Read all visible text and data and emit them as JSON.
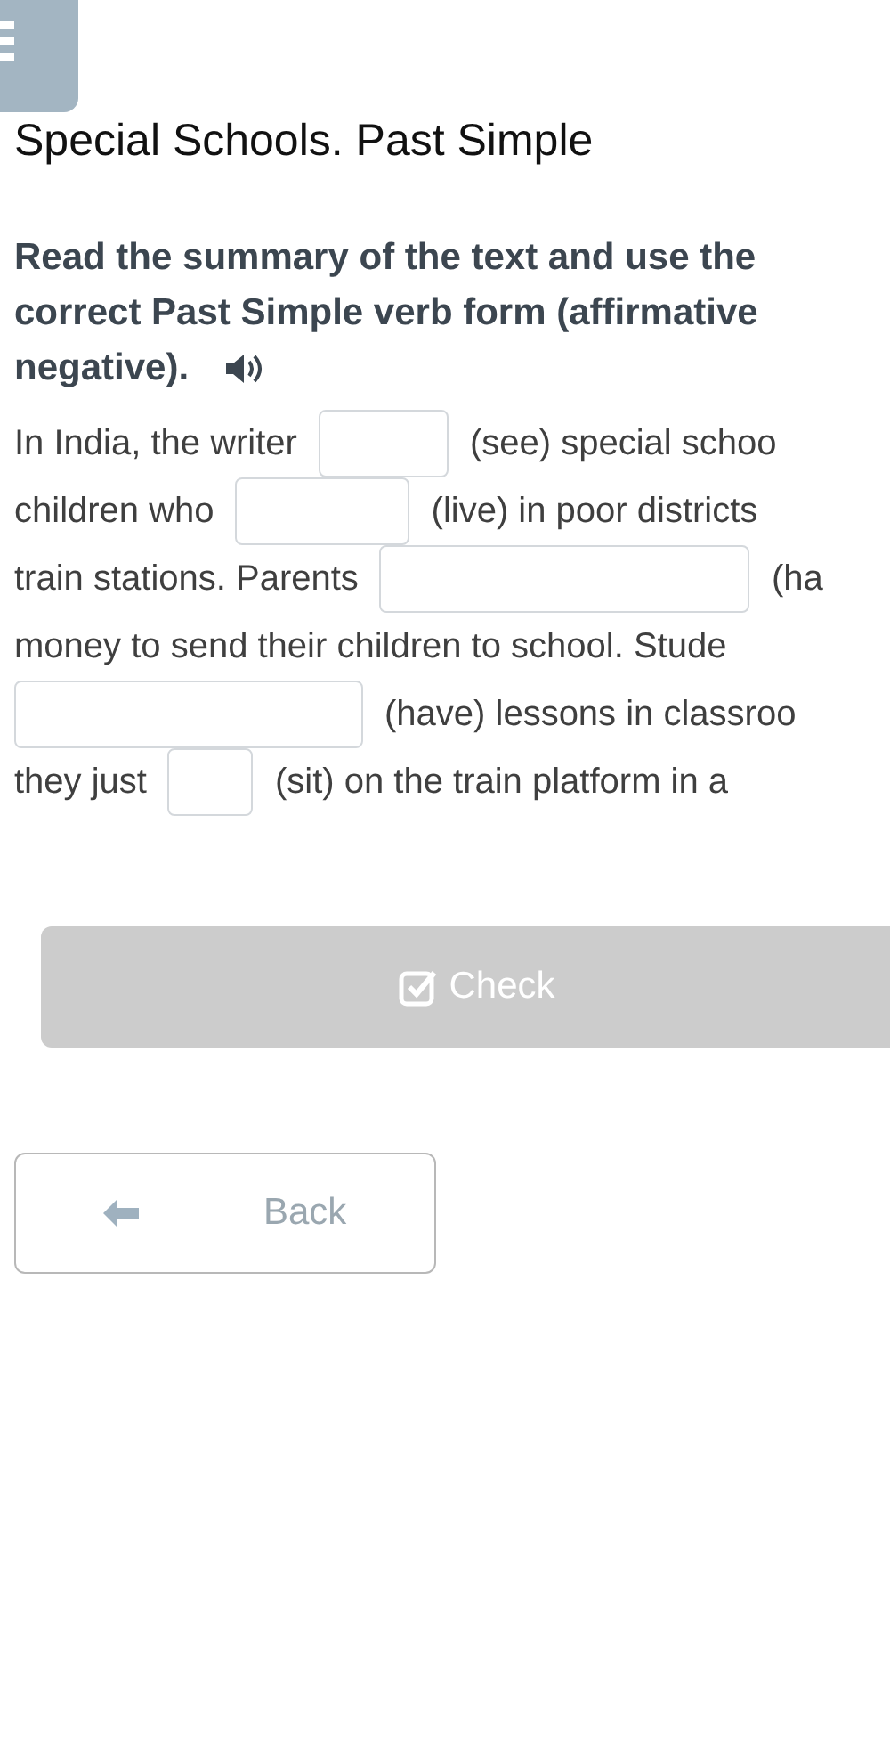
{
  "title": "Special Schools. Past Simple",
  "instruction_lines": [
    "Read the summary of the text and use the",
    "correct Past Simple verb form (affirmative"
  ],
  "instruction_end": "negative).",
  "exercise_lines": [
    [
      {
        "kind": "text",
        "text": "In India, the writer"
      },
      {
        "kind": "blank"
      },
      {
        "kind": "text",
        "text": "(see) special schoo"
      }
    ],
    [
      {
        "kind": "text",
        "text": "children who"
      },
      {
        "kind": "blank"
      },
      {
        "kind": "text",
        "text": "(live) in poor districts"
      }
    ],
    [
      {
        "kind": "text",
        "text": "train stations. Parents"
      },
      {
        "kind": "blank"
      },
      {
        "kind": "text",
        "text": "(ha"
      }
    ],
    [
      {
        "kind": "text",
        "text": "money to send their children to school. Stude"
      }
    ],
    [
      {
        "kind": "blank"
      },
      {
        "kind": "text",
        "text": "(have) lessons in classroo"
      }
    ],
    [
      {
        "kind": "text",
        "text": "they just"
      },
      {
        "kind": "blank"
      },
      {
        "kind": "text",
        "text": "(sit) on the train platform in a"
      }
    ]
  ],
  "check_button": {
    "label": "Check",
    "disabled": true
  },
  "back_button": {
    "label": "Back"
  }
}
